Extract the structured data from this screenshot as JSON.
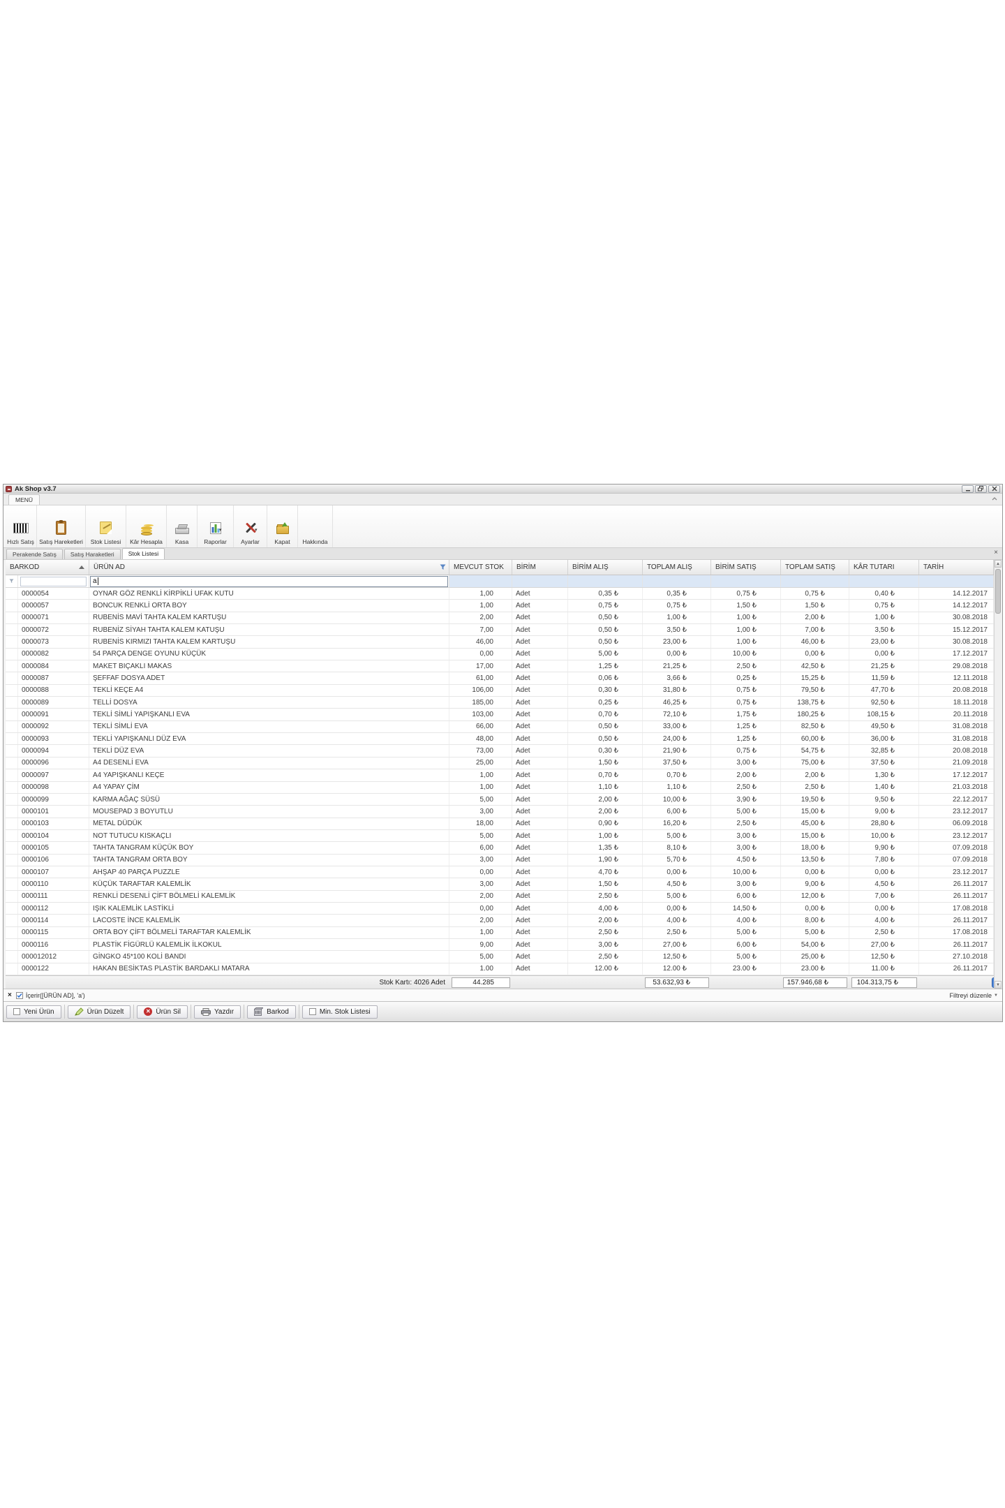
{
  "window": {
    "title": "Ak Shop v3.7",
    "controls": {
      "minimize": "minimize",
      "restore": "restore",
      "close": "close"
    }
  },
  "ribbon": {
    "tab_label": "MENÜ"
  },
  "toolbar": {
    "buttons": [
      {
        "label": "Hızlı Satış",
        "icon": "barcode-icon",
        "dropdown": false
      },
      {
        "label": "Satış Hareketleri",
        "icon": "clipboard-icon",
        "dropdown": false
      },
      {
        "label": "Stok Listesi",
        "icon": "note-pencil-icon",
        "dropdown": false
      },
      {
        "label": "Kâr Hesapla",
        "icon": "coins-icon",
        "dropdown": false
      },
      {
        "label": "Kasa",
        "icon": "cash-register-icon",
        "dropdown": false
      },
      {
        "label": "Raporlar",
        "icon": "bar-chart-icon",
        "dropdown": true
      },
      {
        "label": "Ayarlar",
        "icon": "tools-icon",
        "dropdown": true
      },
      {
        "label": "Kapat",
        "icon": "folder-close-icon",
        "dropdown": false
      },
      {
        "label": "Hakkında",
        "icon": "about-p-icon",
        "dropdown": false
      }
    ]
  },
  "doc_tabs": {
    "tabs": [
      {
        "label": "Perakende Satış",
        "active": false
      },
      {
        "label": "Satış Haraketleri",
        "active": false
      },
      {
        "label": "Stok Listesi",
        "active": true
      }
    ]
  },
  "grid": {
    "columns": [
      {
        "key": "barkod",
        "label": "BARKOD",
        "sorted": true
      },
      {
        "key": "urun_ad",
        "label": "ÜRÜN AD",
        "filtered": true
      },
      {
        "key": "mevcut_stok",
        "label": "MEVCUT STOK"
      },
      {
        "key": "birim",
        "label": "BİRİM"
      },
      {
        "key": "birim_alis",
        "label": "BİRİM ALIŞ"
      },
      {
        "key": "toplam_alis",
        "label": "TOPLAM ALIŞ"
      },
      {
        "key": "birim_satis",
        "label": "BİRİM SATIŞ"
      },
      {
        "key": "toplam_satis",
        "label": "TOPLAM SATIŞ"
      },
      {
        "key": "kar_tutari",
        "label": "KÂR TUTARI"
      },
      {
        "key": "tarih",
        "label": "TARİH"
      }
    ],
    "filter_row": {
      "urun_ad_value": "a"
    },
    "rows": [
      [
        "0000054",
        "OYNAR GÖZ RENKLİ KİRPİKLİ UFAK KUTU",
        "1,00",
        "Adet",
        "0,35 ₺",
        "0,35 ₺",
        "0,75 ₺",
        "0,75 ₺",
        "0,40 ₺",
        "14.12.2017"
      ],
      [
        "0000057",
        "BONCUK RENKLİ ORTA BOY",
        "1,00",
        "Adet",
        "0,75 ₺",
        "0,75 ₺",
        "1,50 ₺",
        "1,50 ₺",
        "0,75 ₺",
        "14.12.2017"
      ],
      [
        "0000071",
        "RUBENİS MAVİ TAHTA KALEM KARTUŞU",
        "2,00",
        "Adet",
        "0,50 ₺",
        "1,00 ₺",
        "1,00 ₺",
        "2,00 ₺",
        "1,00 ₺",
        "30.08.2018"
      ],
      [
        "0000072",
        "RUBENİZ SİYAH TAHTA KALEM KATUŞU",
        "7,00",
        "Adet",
        "0,50 ₺",
        "3,50 ₺",
        "1,00 ₺",
        "7,00 ₺",
        "3,50 ₺",
        "15.12.2017"
      ],
      [
        "0000073",
        "RUBENİS KIRMIZI TAHTA KALEM KARTUŞU",
        "46,00",
        "Adet",
        "0,50 ₺",
        "23,00 ₺",
        "1,00 ₺",
        "46,00 ₺",
        "23,00 ₺",
        "30.08.2018"
      ],
      [
        "0000082",
        "54 PARÇA DENGE OYUNU KÜÇÜK",
        "0,00",
        "Adet",
        "5,00 ₺",
        "0,00 ₺",
        "10,00 ₺",
        "0,00 ₺",
        "0,00 ₺",
        "17.12.2017"
      ],
      [
        "0000084",
        "MAKET BIÇAKLI MAKAS",
        "17,00",
        "Adet",
        "1,25 ₺",
        "21,25 ₺",
        "2,50 ₺",
        "42,50 ₺",
        "21,25 ₺",
        "29.08.2018"
      ],
      [
        "0000087",
        "ŞEFFAF DOSYA ADET",
        "61,00",
        "Adet",
        "0,06 ₺",
        "3,66 ₺",
        "0,25 ₺",
        "15,25 ₺",
        "11,59 ₺",
        "12.11.2018"
      ],
      [
        "0000088",
        "TEKLİ KEÇE A4",
        "106,00",
        "Adet",
        "0,30 ₺",
        "31,80 ₺",
        "0,75 ₺",
        "79,50 ₺",
        "47,70 ₺",
        "20.08.2018"
      ],
      [
        "0000089",
        "TELLİ DOSYA",
        "185,00",
        "Adet",
        "0,25 ₺",
        "46,25 ₺",
        "0,75 ₺",
        "138,75 ₺",
        "92,50 ₺",
        "18.11.2018"
      ],
      [
        "0000091",
        "TEKLİ SİMLİ YAPIŞKANLI EVA",
        "103,00",
        "Adet",
        "0,70 ₺",
        "72,10 ₺",
        "1,75 ₺",
        "180,25 ₺",
        "108,15 ₺",
        "20.11.2018"
      ],
      [
        "0000092",
        "TEKLİ SİMLİ EVA",
        "66,00",
        "Adet",
        "0,50 ₺",
        "33,00 ₺",
        "1,25 ₺",
        "82,50 ₺",
        "49,50 ₺",
        "31.08.2018"
      ],
      [
        "0000093",
        "TEKLİ YAPIŞKANLI DÜZ EVA",
        "48,00",
        "Adet",
        "0,50 ₺",
        "24,00 ₺",
        "1,25 ₺",
        "60,00 ₺",
        "36,00 ₺",
        "31.08.2018"
      ],
      [
        "0000094",
        "TEKLİ DÜZ EVA",
        "73,00",
        "Adet",
        "0,30 ₺",
        "21,90 ₺",
        "0,75 ₺",
        "54,75 ₺",
        "32,85 ₺",
        "20.08.2018"
      ],
      [
        "0000096",
        "A4 DESENLİ EVA",
        "25,00",
        "Adet",
        "1,50 ₺",
        "37,50 ₺",
        "3,00 ₺",
        "75,00 ₺",
        "37,50 ₺",
        "21.09.2018"
      ],
      [
        "0000097",
        "A4 YAPIŞKANLI KEÇE",
        "1,00",
        "Adet",
        "0,70 ₺",
        "0,70 ₺",
        "2,00 ₺",
        "2,00 ₺",
        "1,30 ₺",
        "17.12.2017"
      ],
      [
        "0000098",
        "A4 YAPAY ÇİM",
        "1,00",
        "Adet",
        "1,10 ₺",
        "1,10 ₺",
        "2,50 ₺",
        "2,50 ₺",
        "1,40 ₺",
        "21.03.2018"
      ],
      [
        "0000099",
        "KARMA AĞAÇ SÜSÜ",
        "5,00",
        "Adet",
        "2,00 ₺",
        "10,00 ₺",
        "3,90 ₺",
        "19,50 ₺",
        "9,50 ₺",
        "22.12.2017"
      ],
      [
        "0000101",
        "MOUSEPAD 3 BOYUTLU",
        "3,00",
        "Adet",
        "2,00 ₺",
        "6,00 ₺",
        "5,00 ₺",
        "15,00 ₺",
        "9,00 ₺",
        "23.12.2017"
      ],
      [
        "0000103",
        "METAL DÜDÜK",
        "18,00",
        "Adet",
        "0,90 ₺",
        "16,20 ₺",
        "2,50 ₺",
        "45,00 ₺",
        "28,80 ₺",
        "06.09.2018"
      ],
      [
        "0000104",
        "NOT TUTUCU KISKAÇLI",
        "5,00",
        "Adet",
        "1,00 ₺",
        "5,00 ₺",
        "3,00 ₺",
        "15,00 ₺",
        "10,00 ₺",
        "23.12.2017"
      ],
      [
        "0000105",
        "TAHTA TANGRAM KÜÇÜK BOY",
        "6,00",
        "Adet",
        "1,35 ₺",
        "8,10 ₺",
        "3,00 ₺",
        "18,00 ₺",
        "9,90 ₺",
        "07.09.2018"
      ],
      [
        "0000106",
        "TAHTA TANGRAM ORTA BOY",
        "3,00",
        "Adet",
        "1,90 ₺",
        "5,70 ₺",
        "4,50 ₺",
        "13,50 ₺",
        "7,80 ₺",
        "07.09.2018"
      ],
      [
        "0000107",
        "AHŞAP 40 PARÇA PUZZLE",
        "0,00",
        "Adet",
        "4,70 ₺",
        "0,00 ₺",
        "10,00 ₺",
        "0,00 ₺",
        "0,00 ₺",
        "23.12.2017"
      ],
      [
        "0000110",
        "KÜÇÜK TARAFTAR KALEMLİK",
        "3,00",
        "Adet",
        "1,50 ₺",
        "4,50 ₺",
        "3,00 ₺",
        "9,00 ₺",
        "4,50 ₺",
        "26.11.2017"
      ],
      [
        "0000111",
        "RENKLİ DESENLİ ÇİFT BÖLMELİ KALEMLİK",
        "2,00",
        "Adet",
        "2,50 ₺",
        "5,00 ₺",
        "6,00 ₺",
        "12,00 ₺",
        "7,00 ₺",
        "26.11.2017"
      ],
      [
        "0000112",
        "IŞIK KALEMLİK LASTİKLİ",
        "0,00",
        "Adet",
        "4,00 ₺",
        "0,00 ₺",
        "14,50 ₺",
        "0,00 ₺",
        "0,00 ₺",
        "17.08.2018"
      ],
      [
        "0000114",
        "LACOSTE İNCE KALEMLİK",
        "2,00",
        "Adet",
        "2,00 ₺",
        "4,00 ₺",
        "4,00 ₺",
        "8,00 ₺",
        "4,00 ₺",
        "26.11.2017"
      ],
      [
        "0000115",
        "ORTA BOY ÇİFT BÖLMELİ TARAFTAR KALEMLİK",
        "1,00",
        "Adet",
        "2,50 ₺",
        "2,50 ₺",
        "5,00 ₺",
        "5,00 ₺",
        "2,50 ₺",
        "17.08.2018"
      ],
      [
        "0000116",
        "PLASTİK FİGÜRLÜ KALEMLİK İLKOKUL",
        "9,00",
        "Adet",
        "3,00 ₺",
        "27,00 ₺",
        "6,00 ₺",
        "54,00 ₺",
        "27,00 ₺",
        "26.11.2017"
      ],
      [
        "000012012",
        "GİNGKO 45*100 KOLİ BANDI",
        "5,00",
        "Adet",
        "2,50 ₺",
        "12,50 ₺",
        "5,00 ₺",
        "25,00 ₺",
        "12,50 ₺",
        "27.10.2018"
      ],
      [
        "0000122",
        "HAKAN BESİKTAS PLASTİK BARDAKLI MATARA",
        "1.00",
        "Adet",
        "12.00 ₺",
        "12.00 ₺",
        "23.00 ₺",
        "23.00 ₺",
        "11.00 ₺",
        "26.11.2017"
      ]
    ],
    "summary": {
      "label": "Stok Kartı: 4026 Adet",
      "mevcut_stok": "44.285",
      "toplam_alis": "53.632,93 ₺",
      "toplam_satis": "157.946,68 ₺",
      "kar_tutari": "104.313,75 ₺"
    }
  },
  "filter_bar": {
    "expression": "İçerir([ÜRÜN AD], 'a')",
    "edit_label": "Filtreyi düzenle"
  },
  "bottom_toolbar": {
    "buttons": [
      {
        "label": "Yeni Ürün",
        "icon": "new-item-icon"
      },
      {
        "label": "Ürün Düzelt",
        "icon": "edit-pencil-icon"
      },
      {
        "label": "Ürün Sil",
        "icon": "delete-icon"
      },
      {
        "label": "Yazdır",
        "icon": "printer-icon"
      },
      {
        "label": "Barkod",
        "icon": "barcode-box-icon"
      },
      {
        "label": "Min. Stok Listesi",
        "icon": "checkbox-icon"
      }
    ]
  }
}
